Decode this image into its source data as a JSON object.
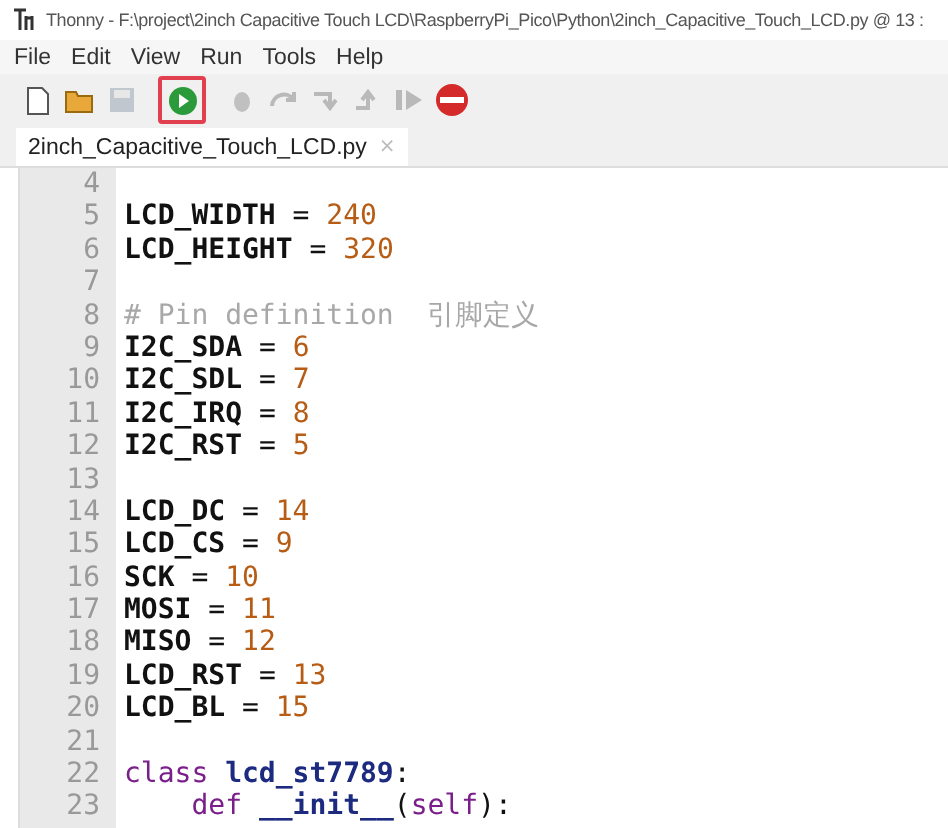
{
  "window": {
    "title": "Thonny  -  F:\\project\\2inch Capacitive Touch LCD\\RaspberryPi_Pico\\Python\\2inch_Capacitive_Touch_LCD.py  @  13 :"
  },
  "menu": [
    "File",
    "Edit",
    "View",
    "Run",
    "Tools",
    "Help"
  ],
  "toolbar": [
    {
      "kind": "new",
      "disabled": false,
      "highlighted": false
    },
    {
      "kind": "open",
      "disabled": false,
      "highlighted": false
    },
    {
      "kind": "save",
      "disabled": true,
      "highlighted": false
    },
    {
      "kind": "run",
      "disabled": false,
      "highlighted": true
    },
    {
      "kind": "debug",
      "disabled": true,
      "highlighted": false
    },
    {
      "kind": "step-over",
      "disabled": true,
      "highlighted": false
    },
    {
      "kind": "step-into",
      "disabled": true,
      "highlighted": false
    },
    {
      "kind": "step-out",
      "disabled": true,
      "highlighted": false
    },
    {
      "kind": "resume",
      "disabled": true,
      "highlighted": false
    },
    {
      "kind": "stop",
      "disabled": false,
      "highlighted": false
    }
  ],
  "tabs": [
    {
      "label": "2inch_Capacitive_Touch_LCD.py",
      "close": "×",
      "selected": true
    }
  ],
  "editor": {
    "lines": [
      {
        "number": "4"
      },
      {
        "number": "5",
        "tokens": [
          {
            "kind": "name",
            "text": "LCD_WIDTH"
          },
          {
            "kind": "op",
            "text": " = "
          },
          {
            "kind": "number",
            "text": "240"
          }
        ]
      },
      {
        "number": "6",
        "tokens": [
          {
            "kind": "name",
            "text": "LCD_HEIGHT"
          },
          {
            "kind": "op",
            "text": " = "
          },
          {
            "kind": "number",
            "text": "320"
          }
        ]
      },
      {
        "number": "7"
      },
      {
        "number": "8",
        "tokens": [
          {
            "kind": "comment",
            "text": "# Pin definition  引脚定义"
          }
        ]
      },
      {
        "number": "9",
        "tokens": [
          {
            "kind": "name",
            "text": "I2C_SDA"
          },
          {
            "kind": "op",
            "text": " = "
          },
          {
            "kind": "number",
            "text": "6"
          }
        ]
      },
      {
        "number": "10",
        "tokens": [
          {
            "kind": "name",
            "text": "I2C_SDL"
          },
          {
            "kind": "op",
            "text": " = "
          },
          {
            "kind": "number",
            "text": "7"
          }
        ]
      },
      {
        "number": "11",
        "tokens": [
          {
            "kind": "name",
            "text": "I2C_IRQ"
          },
          {
            "kind": "op",
            "text": " = "
          },
          {
            "kind": "number",
            "text": "8"
          }
        ]
      },
      {
        "number": "12",
        "tokens": [
          {
            "kind": "name",
            "text": "I2C_RST"
          },
          {
            "kind": "op",
            "text": " = "
          },
          {
            "kind": "number",
            "text": "5"
          }
        ]
      },
      {
        "number": "13"
      },
      {
        "number": "14",
        "tokens": [
          {
            "kind": "name",
            "text": "LCD_DC"
          },
          {
            "kind": "op",
            "text": " = "
          },
          {
            "kind": "number",
            "text": "14"
          }
        ]
      },
      {
        "number": "15",
        "tokens": [
          {
            "kind": "name",
            "text": "LCD_CS"
          },
          {
            "kind": "op",
            "text": " = "
          },
          {
            "kind": "number",
            "text": "9"
          }
        ]
      },
      {
        "number": "16",
        "tokens": [
          {
            "kind": "name",
            "text": "SCK"
          },
          {
            "kind": "op",
            "text": " = "
          },
          {
            "kind": "number",
            "text": "10"
          }
        ]
      },
      {
        "number": "17",
        "tokens": [
          {
            "kind": "name",
            "text": "MOSI"
          },
          {
            "kind": "op",
            "text": " = "
          },
          {
            "kind": "number",
            "text": "11"
          }
        ]
      },
      {
        "number": "18",
        "tokens": [
          {
            "kind": "name",
            "text": "MISO"
          },
          {
            "kind": "op",
            "text": " = "
          },
          {
            "kind": "number",
            "text": "12"
          }
        ]
      },
      {
        "number": "19",
        "tokens": [
          {
            "kind": "name",
            "text": "LCD_RST"
          },
          {
            "kind": "op",
            "text": " = "
          },
          {
            "kind": "number",
            "text": "13"
          }
        ]
      },
      {
        "number": "20",
        "tokens": [
          {
            "kind": "name",
            "text": "LCD_BL"
          },
          {
            "kind": "op",
            "text": " = "
          },
          {
            "kind": "number",
            "text": "15"
          }
        ]
      },
      {
        "number": "21"
      },
      {
        "number": "22",
        "tokens": [
          {
            "kind": "keyword",
            "text": "class "
          },
          {
            "kind": "classname",
            "text": "lcd_st7789"
          },
          {
            "kind": "op",
            "text": ":"
          }
        ]
      },
      {
        "number": "23",
        "tokens": [
          {
            "kind": "keyword",
            "text": "    def "
          },
          {
            "kind": "classname",
            "text": "__init__"
          },
          {
            "kind": "op",
            "text": "("
          },
          {
            "kind": "keyword",
            "text": "self"
          },
          {
            "kind": "op",
            "text": "):"
          }
        ]
      }
    ]
  }
}
